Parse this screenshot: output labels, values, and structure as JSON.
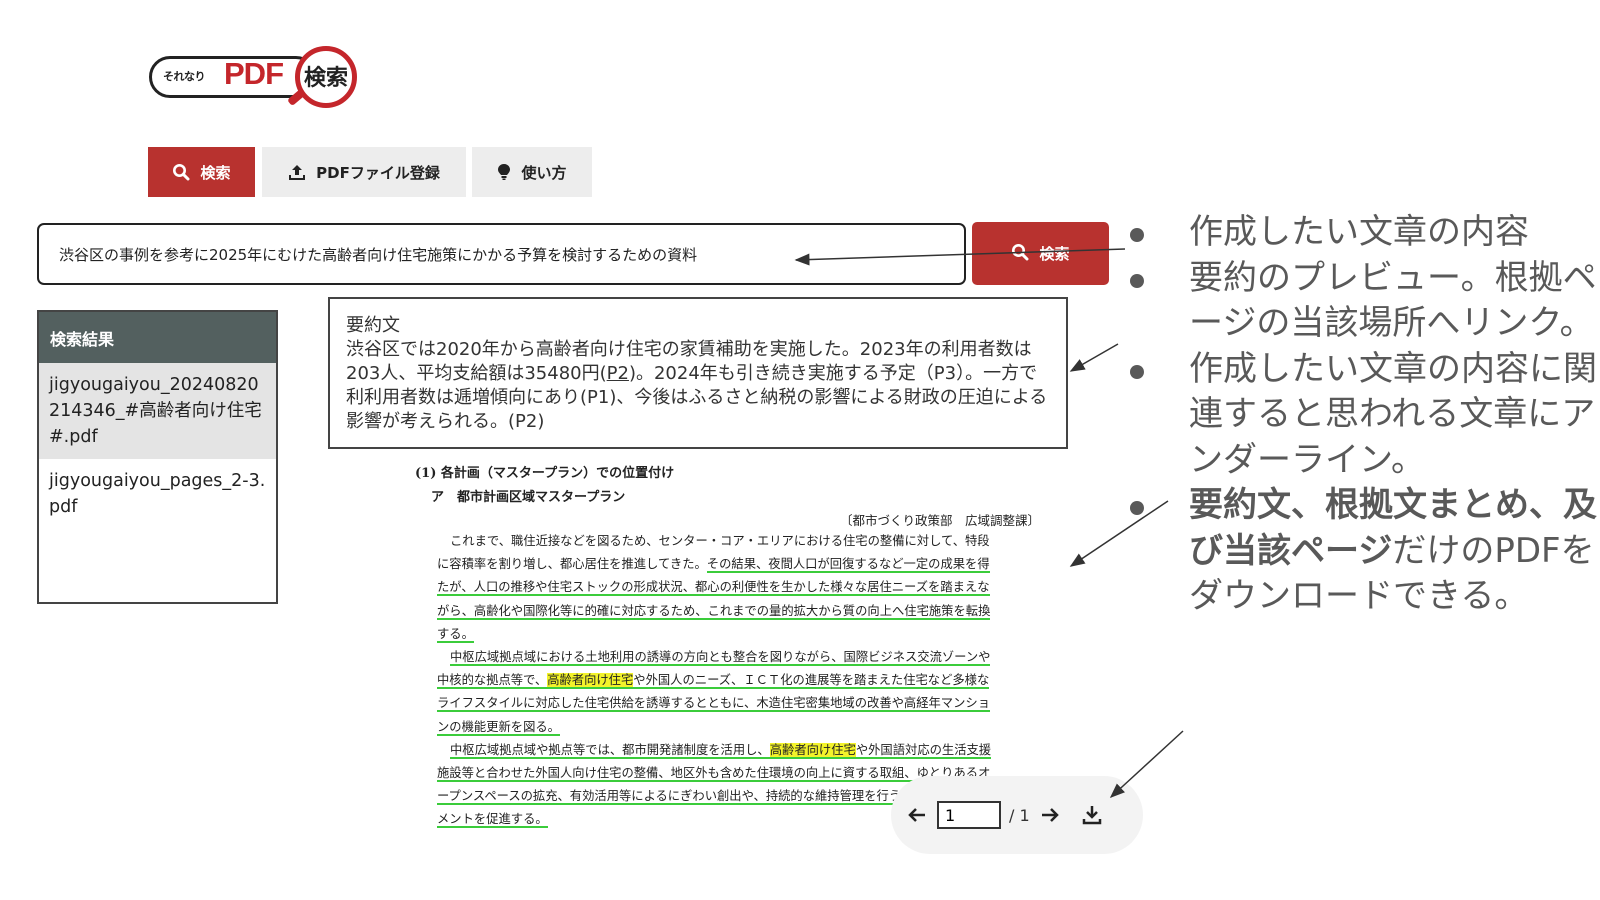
{
  "logo": {
    "small_text": "それなり",
    "pdf_text": "PDF",
    "kanji_text": "検索"
  },
  "nav": {
    "tabs": [
      {
        "label": "検索",
        "icon": "search-icon"
      },
      {
        "label": "PDFファイル登録",
        "icon": "upload-icon"
      },
      {
        "label": "使い方",
        "icon": "lightbulb-icon"
      }
    ]
  },
  "search": {
    "query": "渋谷区の事例を参考に2025年にむけた高齢者向け住宅施策にかかる予算を検討するための資料",
    "button_label": "検索"
  },
  "results": {
    "header": "検索結果",
    "items": [
      {
        "label": "jigyougaiyou_20240820214346_#高齢者向け住宅#.pdf"
      },
      {
        "label": "jigyougaiyou_pages_2-3.pdf"
      }
    ]
  },
  "summary": {
    "title": "要約文",
    "part1": "渋谷区では2020年から高齢者向け住宅の家賃補助を実施した。2023年の利用者数は203人、平均支給額は35480円(",
    "link1": "P2",
    "part2": ")。2024年も引き続き実施する予定（P3）。一方で利利用者数は逓増傾向にあり(P1)、今後はふるさと納税の影響による財政の圧迫による影響が考えられる。(P2)"
  },
  "pdf_page": {
    "heading1": "(1) 各計画（マスタープラン）での位置付け",
    "heading2": "ア　都市計画区域マスタープラン",
    "dept": "〔都市づくり政策部　広域調整課〕",
    "lines": [
      {
        "t1": "これまで、職住近接などを図るため、センター・コア・エリアにおける住宅の整備に対して、特段"
      },
      {
        "t1": "に容積率を割り増し、都心居住を推進してきた。",
        "u1": "その結果、夜間人口が回復するなど一定の成果を得"
      },
      {
        "u1": "たが、人口の推移や住宅ストックの形成状況、都心の利便性を生かした様々な居住ニーズを踏まえな"
      },
      {
        "u1": "がら、高齢化や国際化等に的確に対応するため、これまでの量的拡大から質の向上へ住宅施策を転換"
      },
      {
        "u1": "する。"
      },
      {
        "u1": "中枢広域拠点域における土地利用の誘導の方向とも整合を図りながら、国際ビジネス交流ゾーンや"
      },
      {
        "u1": "中核的な拠点等で、",
        "hl": "高齢者向け住宅",
        "u2": "や外国人のニーズ、ＩＣＴ化の進展等を踏まえた住宅など多様な"
      },
      {
        "u1": "ライフスタイルに対応した住宅供給を誘導するとともに、木造住宅密集地域の改善や高経年マンショ"
      },
      {
        "u1": "ンの機能更新を図る。"
      },
      {
        "u1": "中枢広域拠点域や拠点等では、都市開発諸制度を活用し、",
        "hl": "高齢者向け住宅",
        "u2": "や外国語対応の生活支援"
      },
      {
        "u1": "施設等と合わせた外国人向け住宅の整備、地区外も含めた住環境の向上に資する取組、ゆとりあるオ"
      },
      {
        "u1": "ープンスペースの拡充、有効活用等によるにぎわい創出や、持続的な維持管理を行うエリアマネジ"
      },
      {
        "u1": "メントを促進する。"
      }
    ]
  },
  "pdf_controls": {
    "page_value": "1",
    "page_total": "/ 1"
  },
  "annotations": [
    {
      "text": "作成したい文章の内容"
    },
    {
      "text": "要約のプレビュー。根拠ページの当該場所へリンク。"
    },
    {
      "text": "作成したい文章の内容に関連すると思われる文章にアンダーライン。"
    },
    {
      "bold": "要約文、根拠文まとめ、及び当該ページ",
      "text": "だけのPDFをダウンロードできる。"
    }
  ],
  "colors": {
    "brand_red": "#b8322f",
    "logo_red": "#c4262b",
    "sidebar_header": "#53605f",
    "underline_green": "#3bcc3b",
    "highlight_yellow": "#f3f32a"
  }
}
